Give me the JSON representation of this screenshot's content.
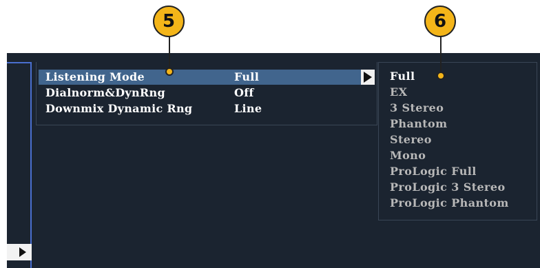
{
  "menu": {
    "items": [
      {
        "label": "Listening Mode",
        "value": "Full"
      },
      {
        "label": "Dialnorm&DynRng",
        "value": "Off"
      },
      {
        "label": "Downmix Dynamic Rng",
        "value": "Line"
      }
    ]
  },
  "submenu": {
    "options": [
      "Full",
      "EX",
      "3 Stereo",
      "Phantom",
      "Stereo",
      "Mono",
      "ProLogic Full",
      "ProLogic 3 Stereo",
      "ProLogic Phantom"
    ],
    "selected": "Full"
  },
  "callouts": [
    "5",
    "6"
  ],
  "colors": {
    "screen_bg": "#1b2430",
    "selection": "#41658d",
    "callout": "#f4b519",
    "bracket": "#4a6fd0"
  }
}
